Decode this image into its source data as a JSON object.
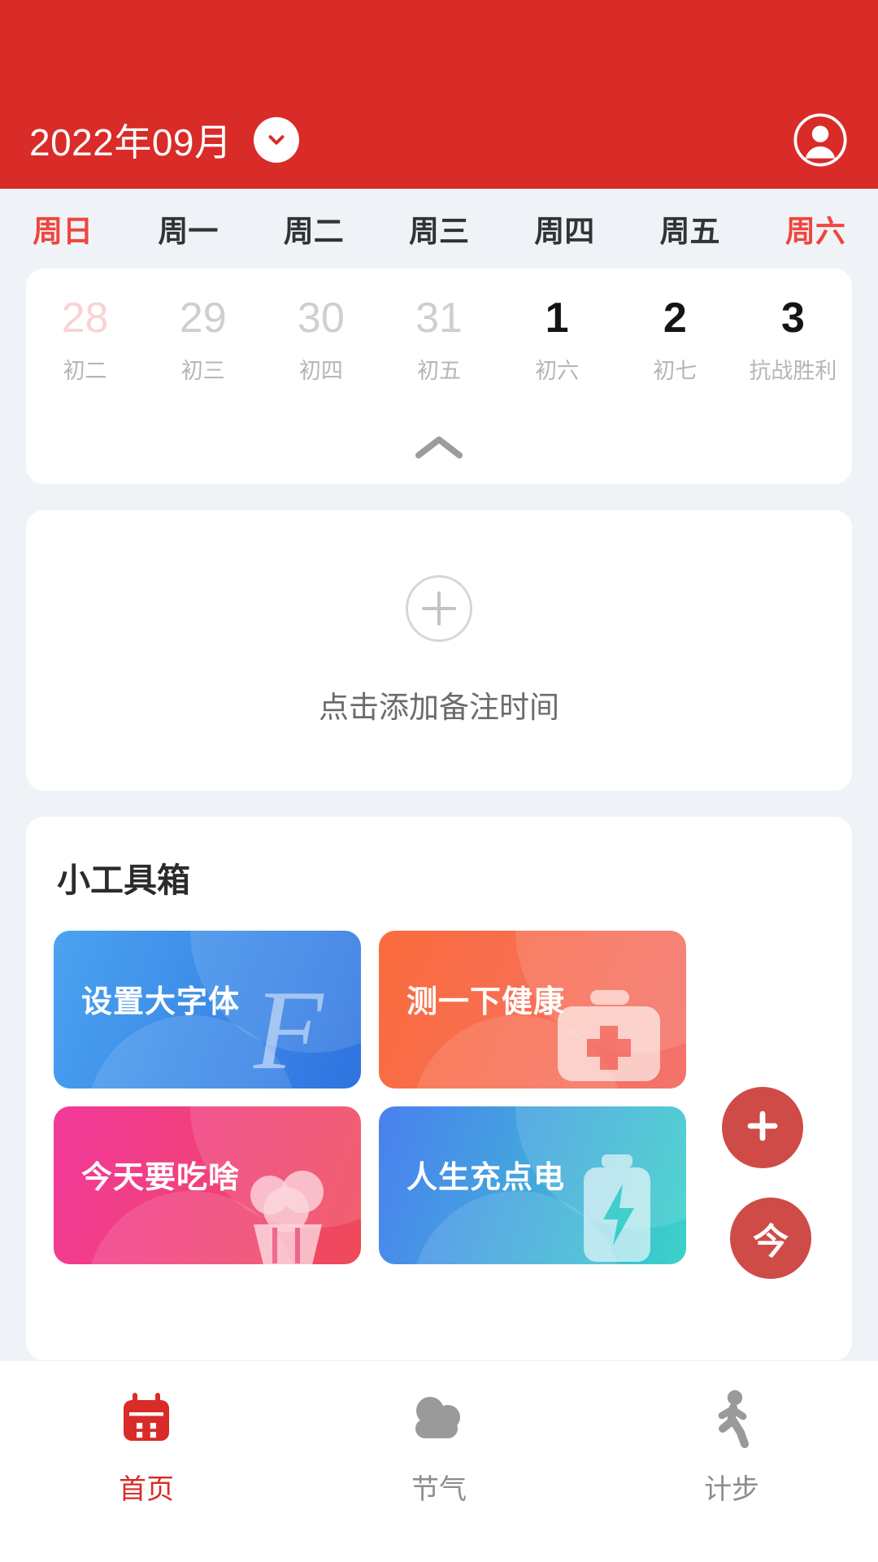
{
  "header": {
    "month_label": "2022年09月",
    "month_toggle_icon": "chevron-down-icon",
    "avatar_icon": "user-avatar-icon",
    "bg_color": "#d92b27"
  },
  "calendar": {
    "weekdays": [
      {
        "label": "周日",
        "accent": true
      },
      {
        "label": "周一",
        "accent": false
      },
      {
        "label": "周二",
        "accent": false
      },
      {
        "label": "周三",
        "accent": false
      },
      {
        "label": "周四",
        "accent": false
      },
      {
        "label": "周五",
        "accent": false
      },
      {
        "label": "周六",
        "accent": true
      }
    ],
    "days": [
      {
        "num": "28",
        "lunar": "初二",
        "style": "muted-accent"
      },
      {
        "num": "29",
        "lunar": "初三",
        "style": "muted"
      },
      {
        "num": "30",
        "lunar": "初四",
        "style": "muted"
      },
      {
        "num": "31",
        "lunar": "初五",
        "style": "muted"
      },
      {
        "num": "1",
        "lunar": "初六",
        "style": "current"
      },
      {
        "num": "2",
        "lunar": "初七",
        "style": "current"
      },
      {
        "num": "3",
        "lunar": "抗战胜利",
        "style": "current"
      }
    ],
    "collapse_icon": "chevron-up-icon"
  },
  "note": {
    "add_icon": "plus-circle-icon",
    "text": "点击添加备注时间"
  },
  "toolbox": {
    "title": "小工具箱",
    "tools": [
      {
        "label": "设置大字体",
        "art": "script-f-icon",
        "color_from": "#4aa3f0",
        "color_to": "#2f73e0"
      },
      {
        "label": "测一下健康",
        "art": "medical-kit-icon",
        "color_from": "#fa6b3c",
        "color_to": "#f4736c"
      },
      {
        "label": "今天要吃啥",
        "art": "cupcake-icon",
        "color_from": "#f2399b",
        "color_to": "#ef4a58"
      },
      {
        "label": "人生充点电",
        "art": "battery-icon",
        "color_from": "#4a7ff0",
        "color_to": "#3ad2c8"
      }
    ]
  },
  "floating": {
    "add_button_label": "+",
    "add_button_icon": "plus-icon",
    "today_button_label": "今",
    "color": "#c42320"
  },
  "bottom_nav": {
    "items": [
      {
        "label": "首页",
        "icon": "calendar-icon",
        "active": true
      },
      {
        "label": "节气",
        "icon": "cloud-icon",
        "active": false
      },
      {
        "label": "计步",
        "icon": "walking-icon",
        "active": false
      }
    ]
  }
}
